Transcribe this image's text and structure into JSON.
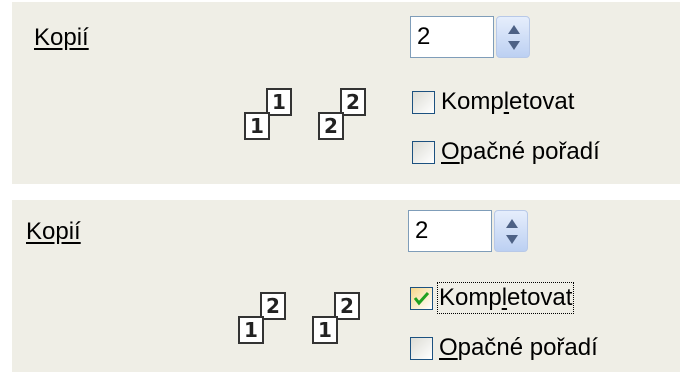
{
  "panel1": {
    "copies_label": "Kopií",
    "copies_value": "2",
    "collate": {
      "label": "Kompletovat",
      "checked": false
    },
    "reverse": {
      "label": "Opačné pořadí",
      "checked": false
    },
    "illustration": {
      "stack1": {
        "back": "1",
        "front": "1"
      },
      "stack2": {
        "back": "2",
        "front": "2"
      }
    }
  },
  "panel2": {
    "copies_label": "Kopií",
    "copies_value": "2",
    "collate": {
      "label": "Kompletovat",
      "checked": true
    },
    "reverse": {
      "label": "Opačné pořadí",
      "checked": false
    },
    "illustration": {
      "stack1": {
        "back": "2",
        "front": "1"
      },
      "stack2": {
        "back": "2",
        "front": "1"
      }
    }
  },
  "colors": {
    "panel_bg": "#efeee6",
    "input_border": "#7f9db9",
    "check_green": "#21a121"
  }
}
